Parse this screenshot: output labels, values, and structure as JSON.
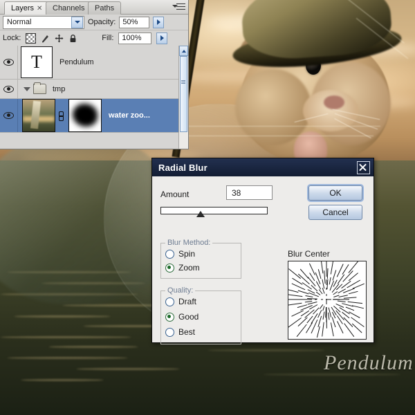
{
  "app": {
    "background_alt": "Sunset seascape photo composite with a hamster wearing a hat",
    "watermark": "Pendulum"
  },
  "layers_panel": {
    "tabs": [
      {
        "label": "Layers",
        "closable": true,
        "active": true
      },
      {
        "label": "Channels",
        "closable": false,
        "active": false
      },
      {
        "label": "Paths",
        "closable": false,
        "active": false
      }
    ],
    "panel_menu_icon": "panel-menu-icon",
    "blend_mode": "Normal",
    "opacity_label": "Opacity:",
    "opacity_value": "50%",
    "lock_label": "Lock:",
    "lock_icons": [
      "lock-transparent-pixels-icon",
      "lock-image-pixels-icon",
      "lock-position-icon",
      "lock-all-icon"
    ],
    "fill_label": "Fill:",
    "fill_value": "100%",
    "layers": [
      {
        "name": "Pendulum",
        "type": "text",
        "thumb_glyph": "T",
        "visible": true,
        "selected": false
      },
      {
        "name": "tmp",
        "type": "group",
        "visible": true,
        "selected": false,
        "expanded": true
      },
      {
        "name": "water zoo...",
        "type": "image",
        "visible": true,
        "selected": true,
        "has_mask": true,
        "linked": true
      }
    ]
  },
  "dialog": {
    "title": "Radial Blur",
    "close_icon": "close-icon",
    "amount_label": "Amount",
    "amount_value": "38",
    "slider_percent": 38,
    "ok_label": "OK",
    "cancel_label": "Cancel",
    "blur_method": {
      "legend": "Blur Method:",
      "options": [
        {
          "label": "Spin",
          "selected": false
        },
        {
          "label": "Zoom",
          "selected": true
        }
      ]
    },
    "quality": {
      "legend": "Quality:",
      "options": [
        {
          "label": "Draft",
          "selected": false
        },
        {
          "label": "Good",
          "selected": true
        },
        {
          "label": "Best",
          "selected": false
        }
      ]
    },
    "blur_center": {
      "label": "Blur Center",
      "preview_icon": "radial-zoom-preview-icon"
    }
  },
  "colors": {
    "dialog_titlebar": "#18223a",
    "dialog_face": "#edecea",
    "selection_blue": "#5a7fb4",
    "default_button_outline": "#9db7dc",
    "radio_selected": "#1c6b2a"
  }
}
